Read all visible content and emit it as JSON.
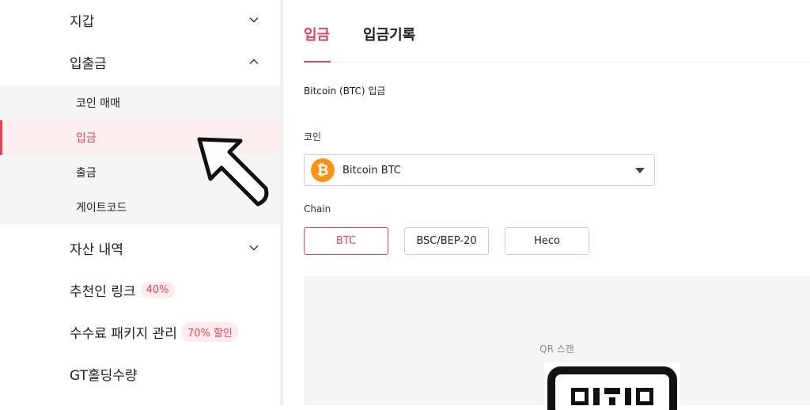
{
  "sidebar": {
    "wallet": "지갑",
    "deposit_withdraw": "입출금",
    "sub": [
      "코인 매매",
      "입금",
      "출금",
      "게이트코드"
    ],
    "asset_history": "자산 내역",
    "referral": {
      "label": "추천인 링크",
      "badge": "40%"
    },
    "fee_package": {
      "label": "수수료 패키지 관리",
      "badge": "70% 할인"
    },
    "gt_holding": "GT홀딩수량"
  },
  "tabs": [
    "입금",
    "입금기록"
  ],
  "section_title": "Bitcoin (BTC) 입금",
  "coin_label": "코인",
  "coin_select": {
    "value": "Bitcoin BTC",
    "icon": "bitcoin-icon",
    "icon_glyph": "₿"
  },
  "chain_label": "Chain",
  "chains": [
    "BTC",
    "BSC/BEP-20",
    "Heco"
  ],
  "qr_label": "QR 스캔",
  "colors": {
    "accent": "#e0455c",
    "btc": "#f7931a",
    "panel": "#f5f5f5"
  }
}
